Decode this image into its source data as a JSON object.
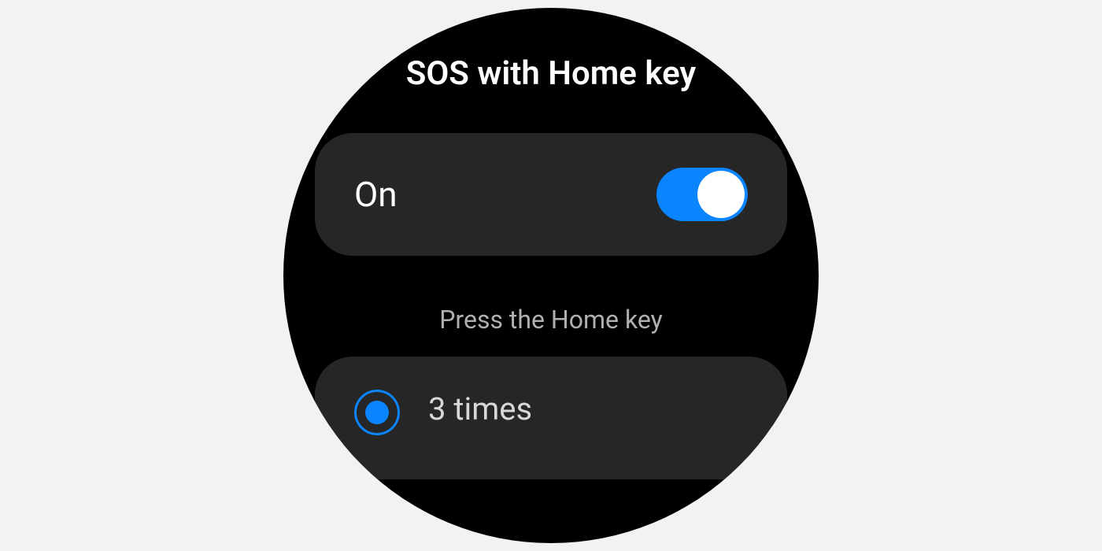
{
  "header": {
    "title": "SOS with Home key"
  },
  "toggle": {
    "label": "On",
    "state": true
  },
  "section": {
    "label": "Press the Home key"
  },
  "options": [
    {
      "label": "3 times",
      "selected": true
    }
  ],
  "colors": {
    "accent": "#0a84ff",
    "background": "#000000",
    "card": "#262626",
    "pageBackground": "#f2f2f2"
  }
}
